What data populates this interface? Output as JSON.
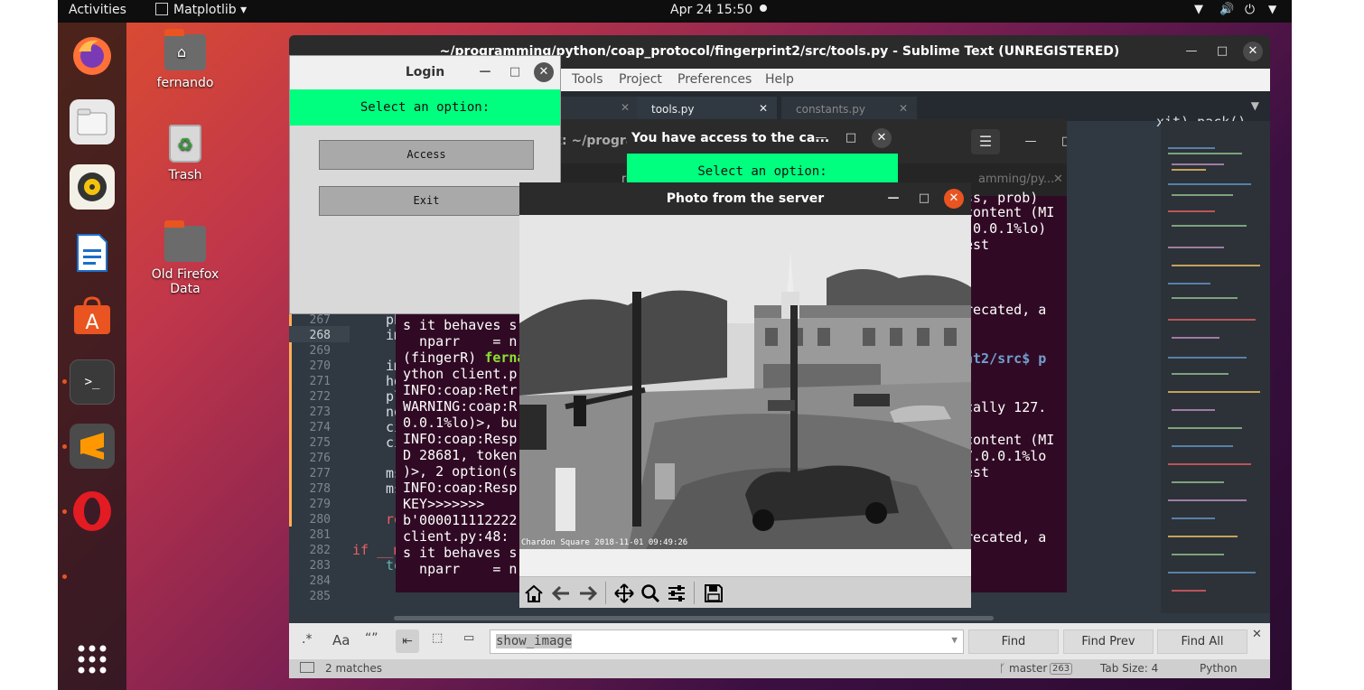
{
  "topbar": {
    "activities": "Activities",
    "app_menu": "Matplotlib",
    "clock": "Apr 24  15:50"
  },
  "dock": {
    "items": [
      "Firefox",
      "Files",
      "Rhythmbox",
      "LibreOffice Writer",
      "Ubuntu Software",
      "Terminal",
      "Sublime Text",
      "Opera",
      "Show Applications"
    ]
  },
  "desktop": {
    "icons": [
      "fernando",
      "Trash",
      "Old Firefox Data"
    ]
  },
  "sublime": {
    "title": "~/programming/python/coap_protocol/fingerprint2/src/tools.py - Sublime Text (UNREGISTERED)",
    "menu": [
      "Tools",
      "Project",
      "Preferences",
      "Help"
    ],
    "tabs": [
      "tools.py",
      "constants.py"
    ],
    "line_numbers": [
      "267",
      "268",
      "269",
      "270",
      "271",
      "272",
      "273",
      "274",
      "275",
      "276",
      "277",
      "278",
      "279",
      "280",
      "281",
      "282",
      "283",
      "284",
      "285"
    ],
    "code_fragments": [
      "ph",
      "im",
      "",
      "im",
      "hd",
      "pl",
      "no",
      "ci",
      "ci",
      "",
      "ms",
      "ms",
      "",
      "re",
      "",
      "if __n",
      "te",
      "",
      ""
    ],
    "top_code_right": "xit).pack()",
    "find_value": "show_image",
    "find_options": [
      ".*",
      "Aa",
      "“”"
    ],
    "find": "Find",
    "find_prev": "Find Prev",
    "find_all": "Find All",
    "status_matches": "2 matches",
    "branch": "master",
    "branch_count": "263",
    "tab_size": "Tab Size: 4",
    "syntax": "Python"
  },
  "terminal": {
    "title_fragment": "x: ~/progra",
    "tab_fragment": "rogramming",
    "tab_fragment2": "amming/py...",
    "lines": [
      "s it behaves s",
      "  nparr    = n",
      "(fingerR) ferna",
      "ython client.p",
      "INFO:coap:Retr",
      "WARNING:coap:R",
      "0.0.1%lo)>, bu",
      "INFO:coap:Resp",
      "D 28681, token",
      ")>, 2 option(s",
      "INFO:coap:Resp",
      "KEY>>>>>>>",
      "b'000011112222",
      "client.py:48: ",
      "s it behaves s",
      "  nparr    = n"
    ],
    "right_lines": [
      "ss, prob)",
      "content (MI",
      ".0.0.1%lo)",
      "est",
      "",
      "recated, a",
      "",
      "nt2/src$ p",
      "",
      "cally 127.",
      "",
      "content (MI",
      "7.0.0.1%lo",
      "est",
      "",
      "recated, a"
    ]
  },
  "access_dialog": {
    "title": "You have access to the ca...",
    "prompt": "Select an option:"
  },
  "login": {
    "title": "Login",
    "prompt": "Select an option:",
    "access": "Access",
    "exit": "Exit"
  },
  "photo": {
    "title": "Photo from the server",
    "caption": "Chardon Square 2018-11-01 09:49:26"
  },
  "colors": {
    "accent_green": "#00ff7f",
    "ubuntu_orange": "#e95420",
    "terminal_bg": "#300a24"
  }
}
